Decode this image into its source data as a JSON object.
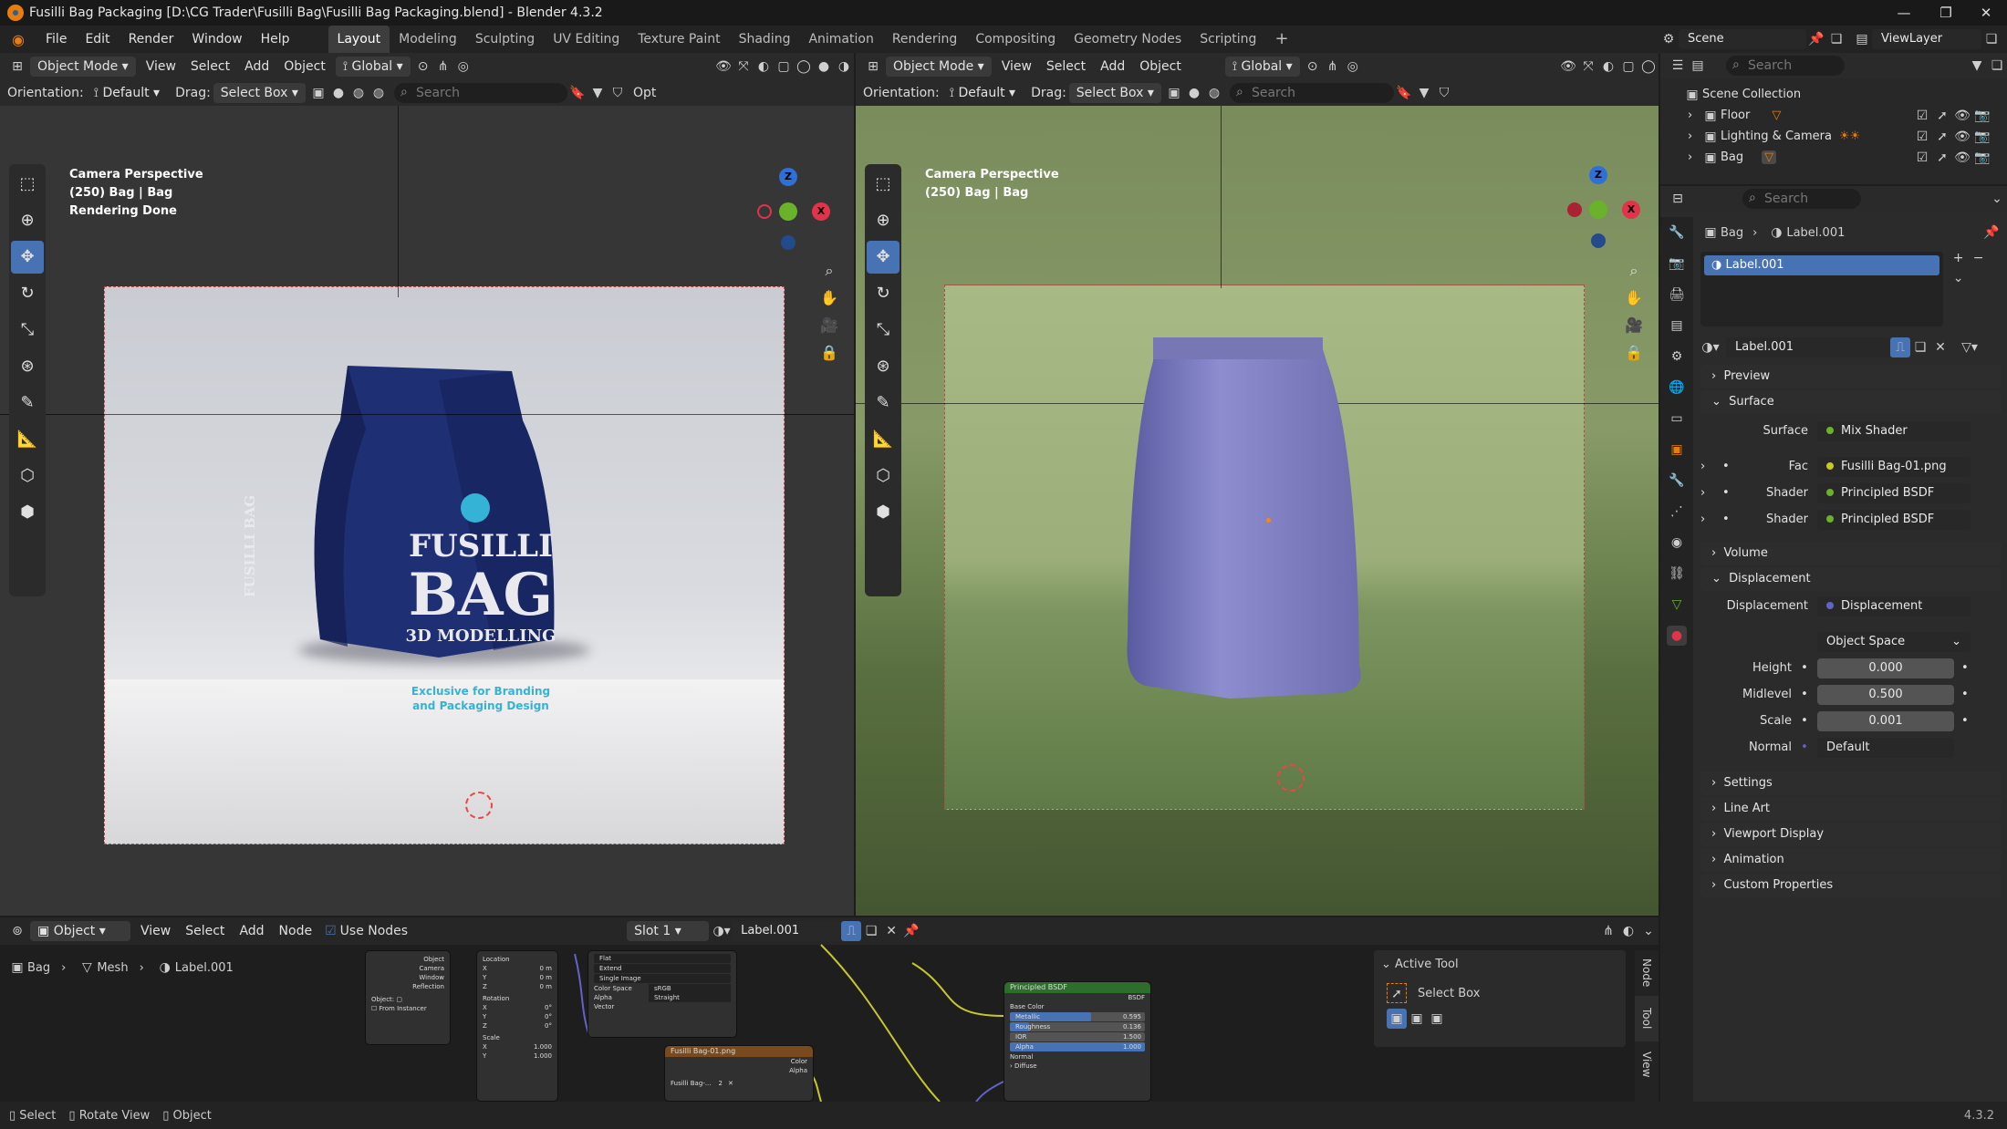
{
  "window": {
    "title": "Fusilli Bag Packaging [D:\\CG Trader\\Fusilli Bag\\Fusilli Bag Packaging.blend] - Blender 4.3.2",
    "controls": [
      "—",
      "❐",
      "✕"
    ]
  },
  "menu": {
    "items": [
      "File",
      "Edit",
      "Render",
      "Window",
      "Help"
    ]
  },
  "workspaces": [
    "Layout",
    "Modeling",
    "Sculpting",
    "UV Editing",
    "Texture Paint",
    "Shading",
    "Animation",
    "Rendering",
    "Compositing",
    "Geometry Nodes",
    "Scripting"
  ],
  "scene": {
    "label": "Scene",
    "view_layer": "ViewLayer"
  },
  "vp_left": {
    "mode": "Object Mode",
    "menus": [
      "View",
      "Select",
      "Add",
      "Object"
    ],
    "transform": "Global",
    "orientation_label": "Orientation:",
    "orientation": "Default",
    "drag_label": "Drag:",
    "drag": "Select Box",
    "search": "Search",
    "opt": "Opt",
    "overlay": [
      "Camera Perspective",
      "(250) Bag | Bag",
      "Rendering Done"
    ]
  },
  "vp_right": {
    "mode": "Object Mode",
    "menus": [
      "View",
      "Select",
      "Add",
      "Object"
    ],
    "transform": "Global",
    "orientation_label": "Orientation:",
    "orientation": "Default",
    "drag_label": "Drag:",
    "drag": "Select Box",
    "search": "Search",
    "overlay": [
      "Camera Perspective",
      "(250) Bag | Bag"
    ]
  },
  "render": {
    "brand1": "FUSILLI",
    "brand2": "BAG",
    "brand3": "3D MODELLING",
    "tag1": "Exclusive for Branding",
    "tag2": "and Packaging Design",
    "side": "FUSILLI BAG",
    "colors": {
      "bag": "#1e2f73",
      "bag_text": "#e9e9ee",
      "tag": "#35b3d6"
    }
  },
  "gizmo": {
    "z": "Z",
    "x": "X"
  },
  "outliner": {
    "search": "Search",
    "collection": "Scene Collection",
    "items": [
      "Floor",
      "Lighting & Camera",
      "Bag"
    ]
  },
  "properties": {
    "search": "Search",
    "breadcrumb": [
      "Bag",
      "Label.001"
    ],
    "slot": "Label.001",
    "material": "Label.001",
    "sections_top": [
      "Preview",
      "Surface"
    ],
    "surface": {
      "label": "Surface",
      "value": "Mix Shader"
    },
    "inputs": [
      {
        "label": "Fac",
        "value": "Fusilli Bag-01.png"
      },
      {
        "label": "Shader",
        "value": "Principled BSDF"
      },
      {
        "label": "Shader",
        "value": "Principled BSDF"
      }
    ],
    "volume": "Volume",
    "displacement_section": "Displacement",
    "displacement": {
      "label": "Displacement",
      "value": "Displacement",
      "space": "Object Space",
      "fields": [
        {
          "label": "Height",
          "value": "0.000"
        },
        {
          "label": "Midlevel",
          "value": "0.500"
        },
        {
          "label": "Scale",
          "value": "0.001"
        },
        {
          "label": "Normal",
          "value": "Default"
        }
      ]
    },
    "sections_bottom": [
      "Settings",
      "Line Art",
      "Viewport Display",
      "Animation",
      "Custom Properties"
    ]
  },
  "node_editor": {
    "type": "Object",
    "menus": [
      "View",
      "Select",
      "Add",
      "Node"
    ],
    "use_nodes": "Use Nodes",
    "slot": "Slot 1",
    "material": "Label.001",
    "breadcrumb": [
      "Bag",
      "Mesh",
      "Label.001"
    ],
    "active_tool": {
      "title": "Active Tool",
      "tool": "Select Box"
    },
    "side_tabs": [
      "Node",
      "Tool",
      "View"
    ],
    "tex_coord": {
      "outputs": [
        "Object",
        "Camera",
        "Window",
        "Reflection"
      ],
      "object_label": "Object:",
      "from_instancer": "From Instancer"
    },
    "mapping": {
      "location": "Location",
      "rotation": "Rotation",
      "scale": "Scale",
      "loc": [
        "0 m",
        "0 m",
        "0 m"
      ],
      "rot": [
        "0°",
        "0°",
        "0°"
      ],
      "scl": [
        "1.000",
        "1.000"
      ],
      "axes": [
        "X",
        "Y",
        "Z"
      ]
    },
    "image_settings": [
      "Flat",
      "Extend",
      "Single Image",
      "sRGB",
      "Straight"
    ],
    "image_labels": [
      "Color Space",
      "Alpha",
      "Vector"
    ],
    "image_node": {
      "title": "Fusilli Bag-01.png",
      "outputs": [
        "Color",
        "Alpha"
      ],
      "file": "Fusilli Bag-...",
      "users": "2"
    },
    "bsdf": {
      "title": "Principled BSDF",
      "out": "BSDF",
      "rows": [
        "Base Color"
      ],
      "sliders": [
        {
          "label": "Metallic",
          "value": "0.595",
          "fill": 0.6
        },
        {
          "label": "Roughness",
          "value": "0.136",
          "fill": 0.14
        },
        {
          "label": "IOR",
          "value": "1.500",
          "fill": 0
        },
        {
          "label": "Alpha",
          "value": "1.000",
          "fill": 1
        }
      ],
      "tail": [
        "Normal",
        "Diffuse"
      ]
    }
  },
  "statusbar": {
    "items": [
      "Select",
      "Rotate View",
      "Object"
    ],
    "version": "4.3.2"
  }
}
